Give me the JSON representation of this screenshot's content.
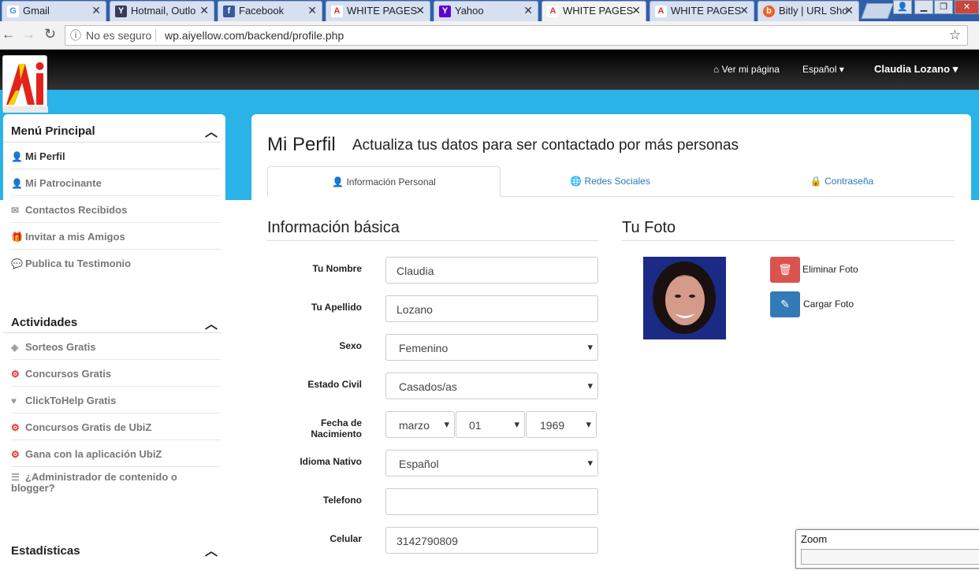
{
  "browser": {
    "tabs": [
      {
        "title": "Gmail",
        "fav": "G",
        "favcolor": "#4285f4",
        "favbg": "#fff"
      },
      {
        "title": "Hotmail, Outlo",
        "fav": "Y",
        "favcolor": "#fff",
        "favbg": "#3a3a5a"
      },
      {
        "title": "Facebook",
        "fav": "f",
        "favcolor": "#fff",
        "favbg": "#3b5998"
      },
      {
        "title": "WHITE PAGES",
        "fav": "A",
        "favcolor": "#d9342b",
        "favbg": "#fff"
      },
      {
        "title": "Yahoo",
        "fav": "Y",
        "favcolor": "#fff",
        "favbg": "#5f01d1"
      },
      {
        "title": "WHITE PAGES",
        "fav": "A",
        "favcolor": "#d9342b",
        "favbg": "#fff"
      },
      {
        "title": "WHITE PAGES",
        "fav": "A",
        "favcolor": "#d9342b",
        "favbg": "#fff"
      },
      {
        "title": "Bitly | URL Sho",
        "fav": "b",
        "favcolor": "#fff",
        "favbg": "#ee6123"
      }
    ],
    "security_label": "No es seguro",
    "url": "wp.aiyellow.com/backend/profile.php"
  },
  "header": {
    "logo_text": "Ai",
    "view_page": "Ver mi página",
    "language": "Español",
    "user": "Claudia Lozano"
  },
  "sidebar": {
    "menu_title": "Menú Principal",
    "menu_items": [
      {
        "label": "Mi Perfil",
        "icon": "user-icon"
      },
      {
        "label": "Mi Patrocinante",
        "icon": "user-icon"
      },
      {
        "label": "Contactos Recibidos",
        "icon": "envelope-icon"
      },
      {
        "label": "Invitar a mis Amigos",
        "icon": "gift-icon"
      },
      {
        "label": "Publica tu Testimonio",
        "icon": "comments-icon"
      }
    ],
    "activities_title": "Actividades",
    "activities": [
      {
        "label": "Sorteos Gratis",
        "icon": "ticket-icon"
      },
      {
        "label": "Concursos Gratis",
        "icon": "cogs-icon"
      },
      {
        "label": "ClickToHelp Gratis",
        "icon": "heart-icon"
      },
      {
        "label": "Concursos Gratis de UbiZ",
        "icon": "cogs-icon"
      },
      {
        "label": "Gana con la aplicación UbiZ",
        "icon": "cogs-icon"
      },
      {
        "label": "¿Administrador de contenido o blogger?",
        "icon": "list-icon"
      }
    ],
    "stats_title": "Estadísticas"
  },
  "main": {
    "title": "Mi Perfil",
    "subtitle": "Actualiza tus datos para ser contactado por más personas",
    "tabs": [
      "Información Personal",
      "Redes Sociales",
      "Contraseña"
    ],
    "basic_title": "Información básica",
    "photo_title": "Tu Foto",
    "fields": {
      "nombre": {
        "label": "Tu Nombre",
        "value": "Claudia"
      },
      "apellido": {
        "label": "Tu Apellido",
        "value": "Lozano"
      },
      "sexo": {
        "label": "Sexo",
        "value": "Femenino"
      },
      "estado": {
        "label": "Estado Civil",
        "value": "Casados/as"
      },
      "fecha": {
        "label": "Fecha de Nacimiento",
        "month": "marzo",
        "day": "01",
        "year": "1969"
      },
      "idioma": {
        "label": "Idioma Nativo",
        "value": "Español"
      },
      "telefono": {
        "label": "Telefono",
        "value": ""
      },
      "celular": {
        "label": "Celular",
        "value": "3142790809"
      }
    },
    "delete_photo": "Eliminar Foto",
    "upload_photo": "Cargar Foto"
  },
  "zoom": {
    "title": "Zoom"
  }
}
